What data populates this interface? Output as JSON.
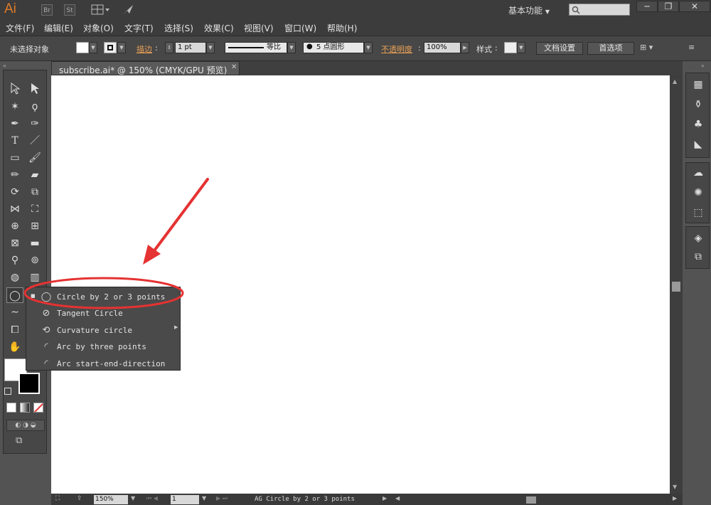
{
  "app": {
    "logo": "Ai",
    "bridge_button": "Br",
    "stock_button": "St",
    "workspace": "基本功能",
    "window_controls": [
      "─",
      "❐",
      "✕"
    ]
  },
  "menu": [
    "文件(F)",
    "编辑(E)",
    "对象(O)",
    "文字(T)",
    "选择(S)",
    "效果(C)",
    "视图(V)",
    "窗口(W)",
    "帮助(H)"
  ],
  "control_bar": {
    "selection_status": "未选择对象",
    "stroke_label": "描边",
    "stroke_weight": "1 pt",
    "stroke_profile": "等比",
    "brush": "5 点圆形",
    "opacity_label": "不透明度",
    "opacity_value": "100%",
    "style_label": "样式",
    "doc_setup": "文档设置",
    "preferences": "首选项"
  },
  "document": {
    "tab_title": "subscribe.ai* @ 150% (CMYK/GPU 预览)",
    "tab_close": "✕"
  },
  "flyout": {
    "items": [
      {
        "label": "Circle by 2 or 3 points",
        "icon": "circle-2-3-points-icon",
        "selected": true
      },
      {
        "label": "Tangent Circle",
        "icon": "tangent-circle-icon"
      },
      {
        "label": "Curvature circle",
        "icon": "curvature-circle-icon"
      },
      {
        "label": "Arc by three points",
        "icon": "arc-three-points-icon"
      },
      {
        "label": "Arc start-end-direction",
        "icon": "arc-start-end-direction-icon"
      }
    ]
  },
  "status_bar": {
    "zoom": "150%",
    "artboard": "1",
    "status_text": "AG Circle by 2 or 3 points"
  },
  "colors": {
    "annotation_red": "#e53232",
    "accent_orange": "#e07a28"
  }
}
